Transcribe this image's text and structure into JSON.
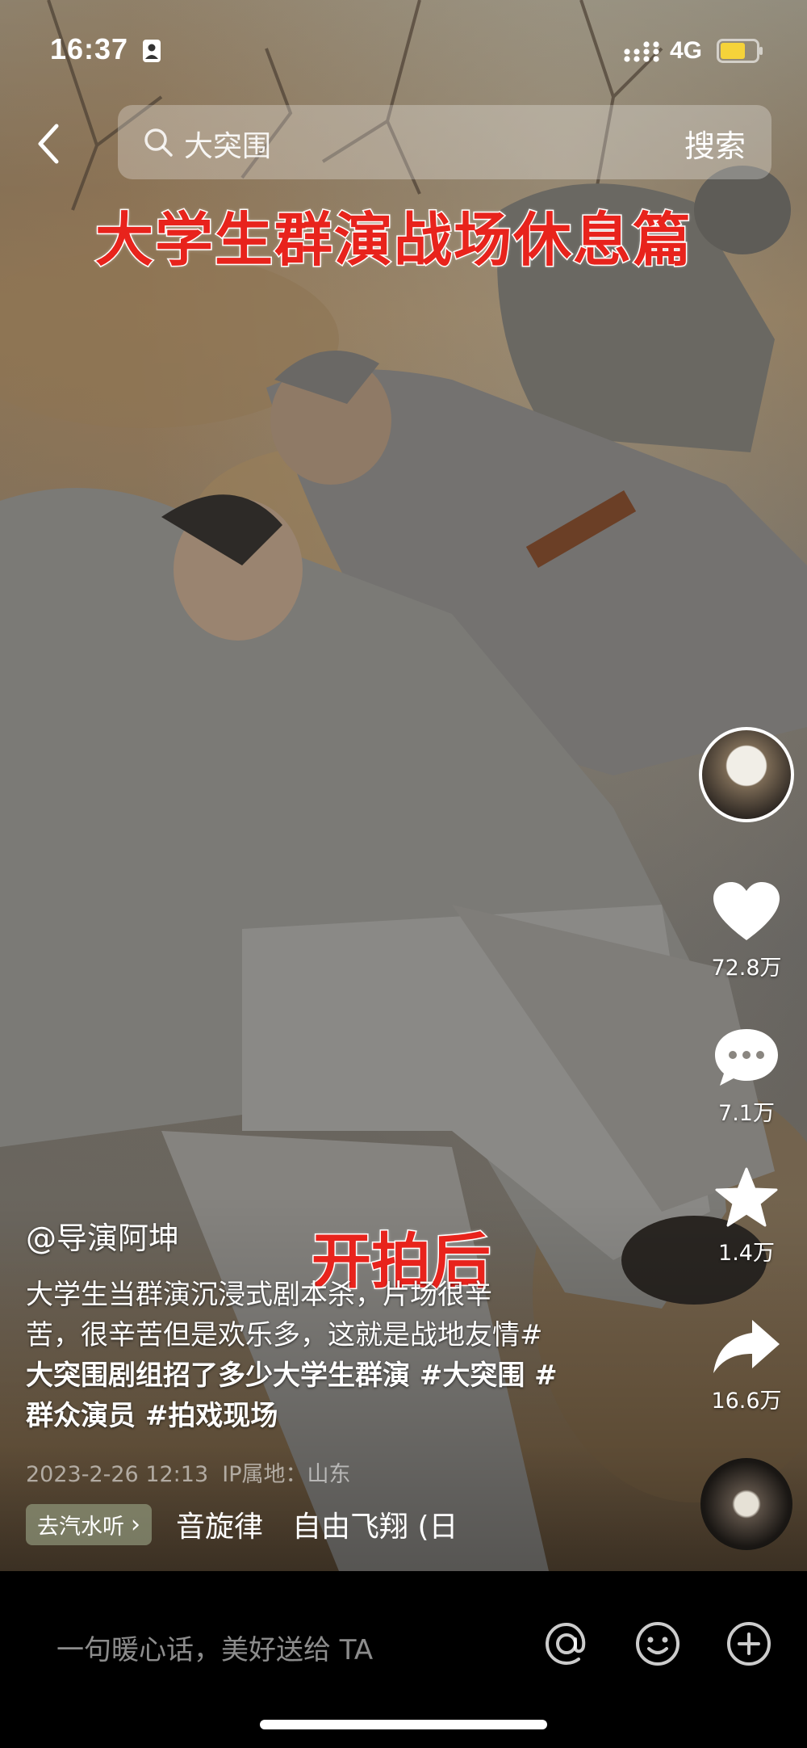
{
  "status_bar": {
    "time": "16:37",
    "network": "4G",
    "battery_color": "#f5d33a"
  },
  "search": {
    "query": "大突围",
    "button_label": "搜索"
  },
  "video": {
    "title_overlay": "大学生群演战场休息篇",
    "subcaption_overlay": "开拍后"
  },
  "actions": {
    "likes": "72.8万",
    "comments": "7.1万",
    "favorites": "1.4万",
    "shares": "16.6万"
  },
  "post": {
    "author": "@导演阿坤",
    "description_line1": "大学生当群演沉浸式剧本杀，片场很辛",
    "description_line2": "苦，很辛苦但是欢乐多，这就是战地友情#",
    "description_line3": "大突围剧组招了多少大学生群演 #大突围 #",
    "description_line4": "群众演员 #拍戏现场",
    "date": "2023-2-26 12:13",
    "ip_location": "IP属地：山东",
    "music_tag": "去汽水听",
    "music_tag_chevron": "›",
    "music_title": "音旋律　自由飞翔 (日"
  },
  "comment_bar": {
    "placeholder": "一句暖心话，美好送给 TA"
  },
  "colors": {
    "caption_red": "#e8231c",
    "background": "#000000"
  }
}
